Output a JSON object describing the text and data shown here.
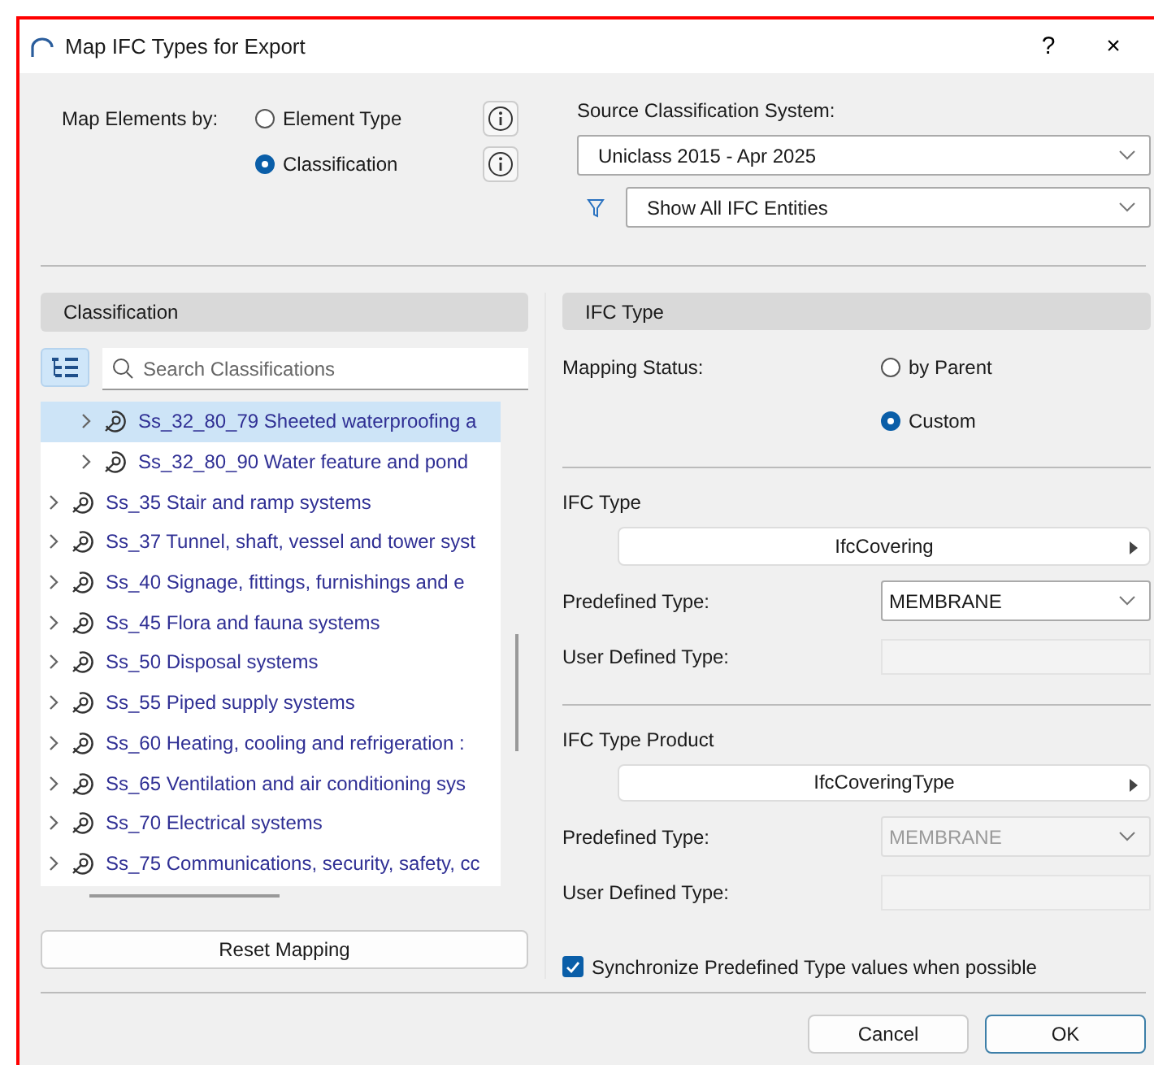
{
  "window": {
    "title": "Map IFC Types for Export",
    "help": "?",
    "close": "×"
  },
  "map_elements_by": {
    "label": "Map Elements by:",
    "options": [
      {
        "label": "Element Type",
        "selected": false
      },
      {
        "label": "Classification",
        "selected": true
      }
    ]
  },
  "source_classification": {
    "label": "Source Classification System:",
    "value": "Uniclass 2015 - Apr 2025"
  },
  "filter": {
    "value": "Show All IFC Entities"
  },
  "classification_panel": {
    "header": "Classification",
    "search": {
      "placeholder": "Search Classifications"
    },
    "tree": [
      {
        "children": [
          {
            "label": "Ss_32_80_79 Sheeted waterproofing a",
            "selected": true,
            "expanded": false
          },
          {
            "label": "Ss_32_80_90 Water feature and pond",
            "selected": false,
            "expanded": false
          }
        ]
      },
      {
        "label": "Ss_35 Stair and ramp systems",
        "selected": false,
        "expanded": false
      },
      {
        "label": "Ss_37 Tunnel, shaft, vessel and tower syst",
        "selected": false,
        "expanded": false
      },
      {
        "label": "Ss_40 Signage, fittings, furnishings and e",
        "selected": false,
        "expanded": false
      },
      {
        "label": "Ss_45 Flora and fauna systems",
        "selected": false,
        "expanded": false
      },
      {
        "label": "Ss_50 Disposal systems",
        "selected": false,
        "expanded": false
      },
      {
        "label": "Ss_55 Piped supply systems",
        "selected": false,
        "expanded": false
      },
      {
        "label": "Ss_60 Heating, cooling and refrigeration :",
        "selected": false,
        "expanded": false
      },
      {
        "label": "Ss_65 Ventilation and air conditioning sys",
        "selected": false,
        "expanded": false
      },
      {
        "label": "Ss_70 Electrical systems",
        "selected": false,
        "expanded": false
      },
      {
        "label": "Ss_75 Communications, security, safety, cc",
        "selected": false,
        "expanded": false
      }
    ],
    "reset_button": "Reset Mapping"
  },
  "ifc_type_panel": {
    "header": "IFC Type",
    "mapping_status": {
      "label": "Mapping Status:",
      "options": [
        {
          "label": "by Parent",
          "selected": false
        },
        {
          "label": "Custom",
          "selected": true
        }
      ]
    },
    "sections": [
      {
        "title": "IFC Type",
        "type_button": "IfcCovering",
        "predefined": {
          "label": "Predefined Type:",
          "value": "MEMBRANE",
          "disabled": false
        },
        "user_defined": {
          "label": "User Defined Type:",
          "disabled": true
        }
      },
      {
        "title": "IFC Type Product",
        "type_button": "IfcCoveringType",
        "predefined": {
          "label": "Predefined Type:",
          "value": "MEMBRANE",
          "disabled": true
        },
        "user_defined": {
          "label": "User Defined Type:",
          "disabled": true
        }
      }
    ],
    "sync_checkbox": {
      "label": "Synchronize Predefined Type values when possible",
      "checked": true
    }
  },
  "footer_buttons": [
    {
      "label": "Cancel",
      "default": false
    },
    {
      "label": "OK",
      "default": true
    }
  ]
}
